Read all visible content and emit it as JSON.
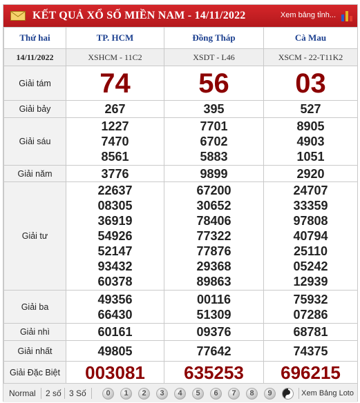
{
  "header": {
    "title": "KẾT QUẢ XỔ SỐ MIỀN NAM - 14/11/2022",
    "link": "Xem bảng tỉnh...",
    "icons": [
      "mail-icon",
      "bar-chart-icon"
    ],
    "brand_color": "#c41e22"
  },
  "table": {
    "day": "Thứ hai",
    "date": "14/11/2022",
    "provinces": [
      {
        "name": "TP. HCM",
        "code": "XSHCM - 11C2"
      },
      {
        "name": "Đồng Tháp",
        "code": "XSDT - L46"
      },
      {
        "name": "Cà Mau",
        "code": "XSCM - 22-T11K2"
      }
    ],
    "prizes": [
      {
        "label": "Giải tám",
        "values": [
          [
            "74"
          ],
          [
            "56"
          ],
          [
            "03"
          ]
        ]
      },
      {
        "label": "Giải bảy",
        "values": [
          [
            "267"
          ],
          [
            "395"
          ],
          [
            "527"
          ]
        ]
      },
      {
        "label": "Giải sáu",
        "values": [
          [
            "1227",
            "7470",
            "8561"
          ],
          [
            "7701",
            "6702",
            "5883"
          ],
          [
            "8905",
            "4903",
            "1051"
          ]
        ]
      },
      {
        "label": "Giải năm",
        "values": [
          [
            "3776"
          ],
          [
            "9899"
          ],
          [
            "2920"
          ]
        ]
      },
      {
        "label": "Giải tư",
        "values": [
          [
            "22637",
            "08305",
            "36919",
            "54926",
            "52147",
            "93432",
            "60378"
          ],
          [
            "67200",
            "30652",
            "78406",
            "77322",
            "77876",
            "29368",
            "89863"
          ],
          [
            "24707",
            "33359",
            "97808",
            "40794",
            "25110",
            "05242",
            "12939"
          ]
        ]
      },
      {
        "label": "Giải ba",
        "values": [
          [
            "49356",
            "66430"
          ],
          [
            "00116",
            "51309"
          ],
          [
            "75932",
            "07286"
          ]
        ]
      },
      {
        "label": "Giải nhì",
        "values": [
          [
            "60161"
          ],
          [
            "09376"
          ],
          [
            "68781"
          ]
        ]
      },
      {
        "label": "Giải nhất",
        "values": [
          [
            "49805"
          ],
          [
            "77642"
          ],
          [
            "74375"
          ]
        ]
      },
      {
        "label": "Giải Đặc Biệt",
        "values": [
          [
            "003081"
          ],
          [
            "635253"
          ],
          [
            "696215"
          ]
        ]
      }
    ],
    "accent_number_color": "#8b0000"
  },
  "footer": {
    "modes": [
      "Normal",
      "2 số",
      "3 Số"
    ],
    "digits": [
      "0",
      "1",
      "2",
      "3",
      "4",
      "5",
      "6",
      "7",
      "8",
      "9"
    ],
    "loto_link": "Xem Bảng Loto"
  }
}
